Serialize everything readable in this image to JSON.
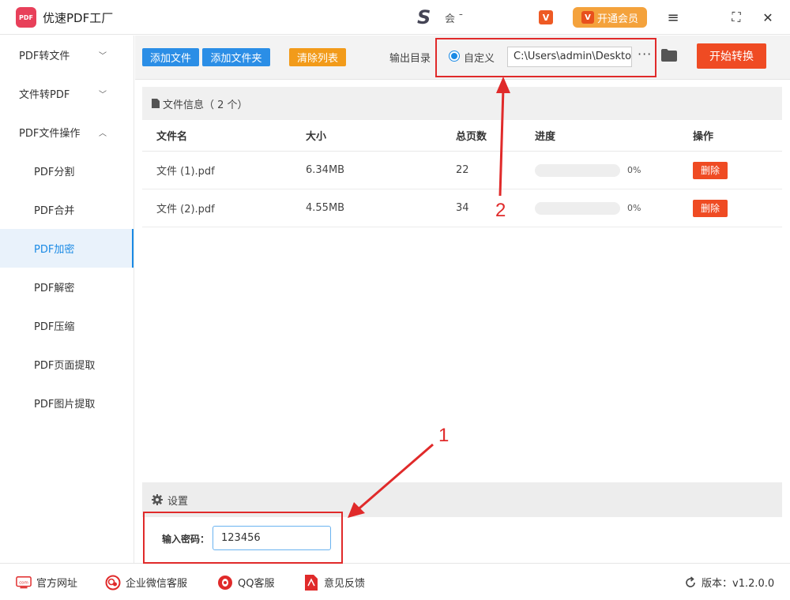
{
  "titlebar": {
    "app_title": "优速PDF工厂",
    "logo_text": "PDF",
    "user_mark": "S",
    "user_text": "会 ¯",
    "vip_mini": "V",
    "vip_label": "开通会员",
    "vip_icon": "V",
    "menu_icon": "≡",
    "max_icon": "⛶",
    "close_icon": "✕"
  },
  "sidebar": {
    "items": [
      {
        "label": "PDF转文件",
        "chevron": "﹀"
      },
      {
        "label": "文件转PDF",
        "chevron": "﹀"
      },
      {
        "label": "PDF文件操作",
        "chevron": "︿"
      }
    ],
    "subitems": [
      "PDF分割",
      "PDF合并",
      "PDF加密",
      "PDF解密",
      "PDF压缩",
      "PDF页面提取",
      "PDF图片提取"
    ],
    "active": "PDF加密"
  },
  "toolbar": {
    "add_file": "添加文件",
    "add_folder": "添加文件夹",
    "clear_list": "清除列表",
    "output_label": "输出目录",
    "custom_label": "自定义",
    "path_value": "C:\\Users\\admin\\Desktop",
    "more": "···",
    "start": "开始转换"
  },
  "file_panel": {
    "header": "文件信息（ 2 个）",
    "columns": [
      "文件名",
      "大小",
      "总页数",
      "进度",
      "操作"
    ],
    "rows": [
      {
        "name": "文件 (1).pdf",
        "size": "6.34MB",
        "pages": "22",
        "progress": "0%",
        "progress_value": 0,
        "action": "删除"
      },
      {
        "name": "文件 (2).pdf",
        "size": "4.55MB",
        "pages": "34",
        "progress": "0%",
        "progress_value": 0,
        "action": "删除"
      }
    ]
  },
  "settings": {
    "title": "设置",
    "password_label": "输入密码：",
    "password_value": "123456"
  },
  "footer": {
    "website": "官方网址",
    "wechat": "企业微信客服",
    "qq": "QQ客服",
    "feedback": "意见反馈",
    "version": "版本：v1.2.0.0",
    "website_icon_text": "com"
  },
  "annotations": {
    "num1": "1",
    "num2": "2"
  },
  "colors": {
    "accent_blue": "#1a8ae5",
    "orange": "#f4a23c",
    "red": "#ef4b23",
    "annotation_red": "#e02a2a"
  }
}
